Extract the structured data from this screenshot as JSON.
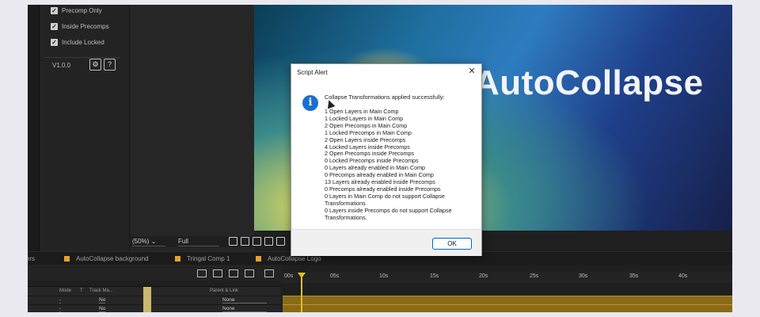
{
  "panel": {
    "options": [
      {
        "label": "Precomp Only",
        "checked": true
      },
      {
        "label": "Inside Precomps",
        "checked": true
      },
      {
        "label": "Include Locked",
        "checked": true
      }
    ],
    "version": "V1.0.0",
    "settings_icon": "gear-icon",
    "help_label": "?"
  },
  "viewer": {
    "title_text": "AutoCollapse",
    "zoom": "(50%)",
    "resolution": "Full"
  },
  "comp_tabs": [
    {
      "label": "ers"
    },
    {
      "label": "AutoCollapse background"
    },
    {
      "label": "Tringal Comp 1"
    },
    {
      "label": "AutoCollapse Logo"
    }
  ],
  "timeline": {
    "ruler": [
      "00s",
      "05s",
      "10s",
      "15s",
      "20s",
      "25s",
      "30s",
      "35s",
      "40s"
    ],
    "columns": {
      "mode": "Mode",
      "t": "T",
      "track_matte": "Track Ma...",
      "parent": "Parent & Link"
    },
    "layers": [
      {
        "mode": "-",
        "track": "No",
        "parent": "None"
      },
      {
        "mode": "-",
        "track": "No",
        "parent": "None"
      }
    ]
  },
  "dialog": {
    "title": "Script Alert",
    "close": "✕",
    "icon": "info-icon",
    "header": "Collapse Transformations applied successfully:",
    "lines": [
      "1 Open Layers in Main Comp",
      "1 Locked Layers in Main Comp",
      "2 Open Precomps in Main Comp",
      "1 Locked Precomps in Main Comp",
      "2 Open Layers inside Precomps",
      "4 Locked Layers inside Precomps",
      "2 Open Precomps inside Precomps",
      "0 Locked Precomps inside Precomps",
      "0 Layers already enabled in Main Comp",
      "0 Precomps already enabled in Main Comp",
      "13 Layers already enabled inside Precomps",
      "0 Precomps already enabled inside Precomps",
      "0 Layers in Main Comp do not support Collapse Transformations",
      "0 Layers inside Precomps do not support Collapse Transformations."
    ],
    "ok_label": "OK"
  }
}
